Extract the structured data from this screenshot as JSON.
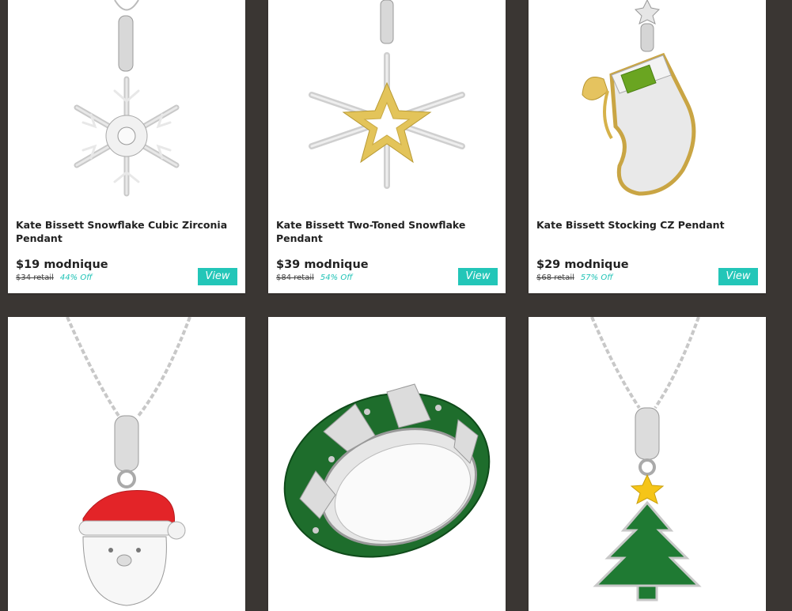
{
  "products": [
    {
      "title": "Kate Bissett Snowflake Cubic Zirconia Pendant",
      "price": "$19 modnique",
      "retail": "$34 retail",
      "discount": "44% Off",
      "view": "View"
    },
    {
      "title": "Kate Bissett Two-Toned Snowflake Pendant",
      "price": "$39 modnique",
      "retail": "$84 retail",
      "discount": "54% Off",
      "view": "View"
    },
    {
      "title": "Kate Bissett Stocking CZ Pendant",
      "price": "$29 modnique",
      "retail": "$68 retail",
      "discount": "57% Off",
      "view": "View"
    }
  ],
  "images": [
    {
      "icon": "snowflake-pendant-icon"
    },
    {
      "icon": "star-snowflake-pendant-icon"
    },
    {
      "icon": "stocking-pendant-icon"
    },
    {
      "icon": "santa-pendant-icon"
    },
    {
      "icon": "green-enamel-ring-icon"
    },
    {
      "icon": "christmas-tree-pendant-icon"
    }
  ],
  "colors": {
    "background": "#3a3633",
    "accent": "#23c6b8",
    "discount": "#1fc3b6"
  }
}
